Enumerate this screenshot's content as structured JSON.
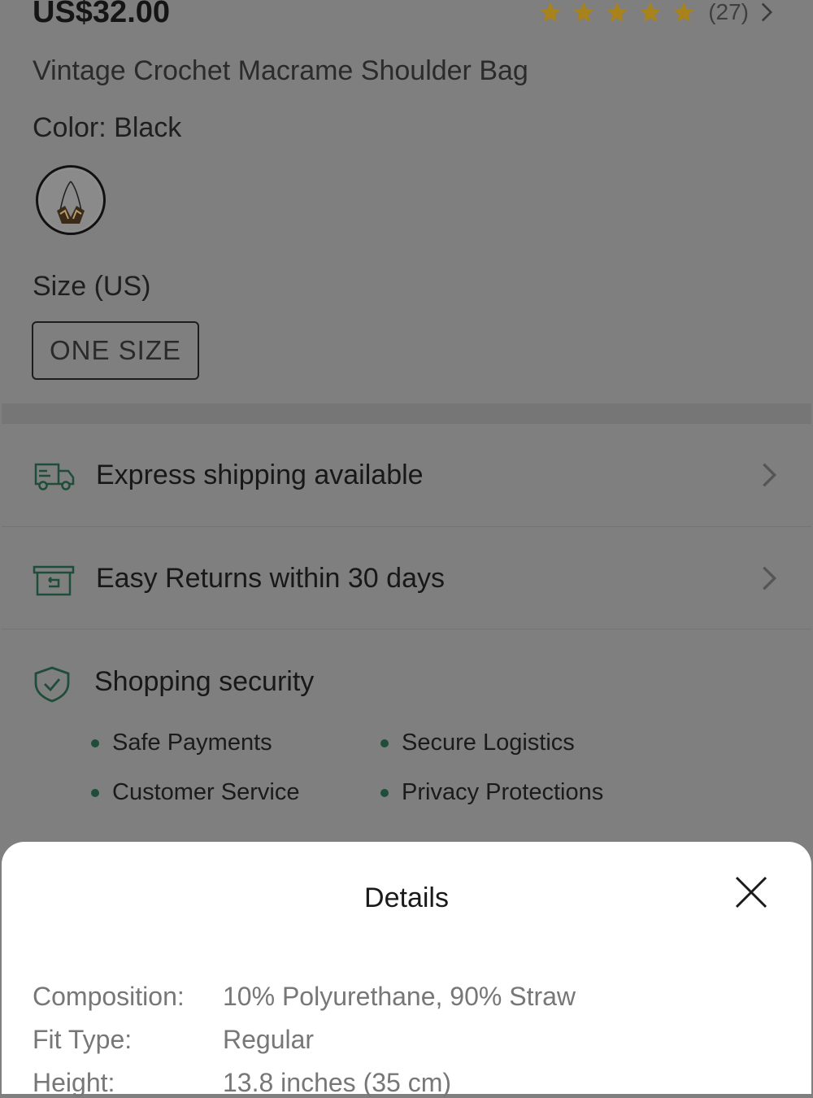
{
  "product": {
    "price": "US$32.00",
    "rating_count": "(27)",
    "rating_stars": 5,
    "title": "Vintage Crochet Macrame Shoulder Bag",
    "color_label": "Color: Black",
    "size_label": "Size (US)",
    "size_option": "ONE SIZE"
  },
  "services": {
    "shipping": "Express shipping available",
    "returns": "Easy Returns within 30 days",
    "security": "Shopping security",
    "security_items": [
      "Safe Payments",
      "Secure Logistics",
      "Customer Service",
      "Privacy Protections"
    ]
  },
  "details_sheet": {
    "title": "Details",
    "rows": [
      {
        "label": "Composition:",
        "value": "10% Polyurethane, 90% Straw"
      },
      {
        "label": "Fit Type:",
        "value": "Regular"
      },
      {
        "label": "Height:",
        "value": "13.8 inches (35 cm)"
      }
    ]
  },
  "colors": {
    "accent_star": "#a8821a",
    "icon_green": "#1f4d3a",
    "overlay": "#7f7f7f"
  },
  "icons": {
    "star": "star-icon",
    "chevron": "chevron-right-icon",
    "truck": "truck-icon",
    "returns_box": "return-box-icon",
    "shield": "shield-check-icon",
    "close": "close-icon"
  }
}
